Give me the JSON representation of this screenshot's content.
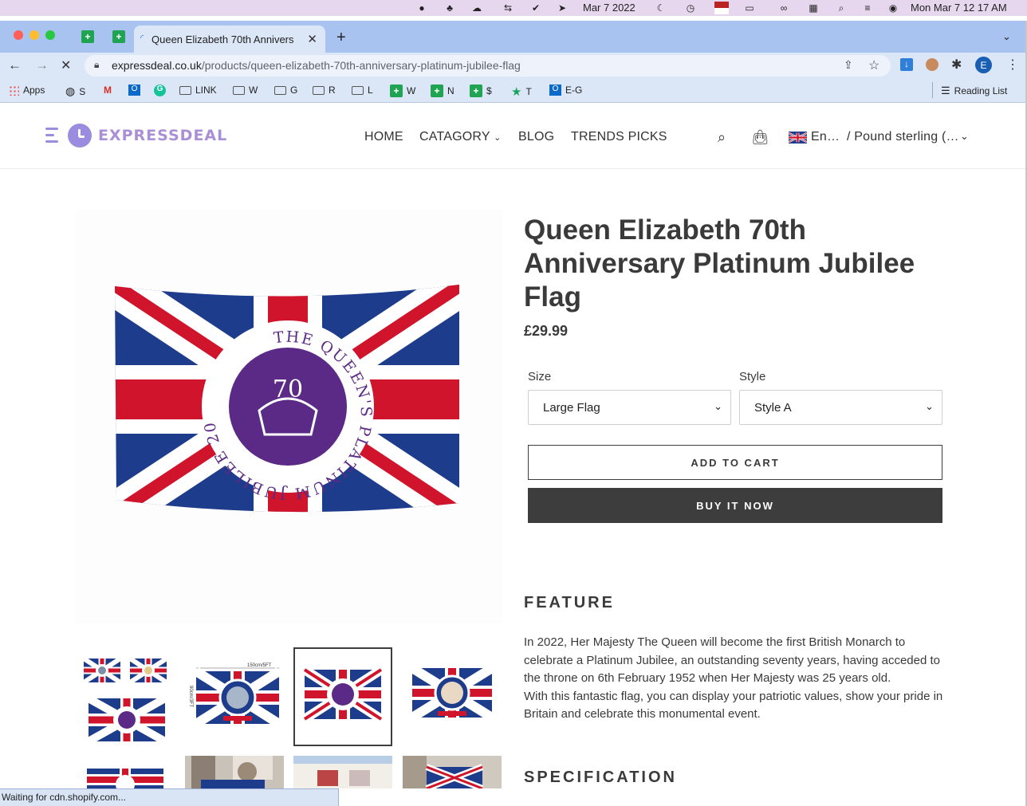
{
  "system_menubar": {
    "date_short": "Mar 7 2022",
    "clock": "Mon Mar 7  12 17 AM"
  },
  "browser": {
    "active_tab_title": "Queen Elizabeth 70th Annivers",
    "url_host": "expressdeal.co.uk",
    "url_path": "/products/queen-elizabeth-70th-anniversary-platinum-jubilee-flag",
    "profile_initial": "E",
    "bookmarks": [
      "Apps",
      "S",
      "LINK",
      "W",
      "G",
      "R",
      "L",
      "W",
      "N",
      "$",
      "T",
      "E-G"
    ],
    "reading_list": "Reading List",
    "status_text": "Waiting for cdn.shopify.com..."
  },
  "site": {
    "logo_text": "EXPRESSDEAL",
    "nav": [
      "HOME",
      "CATAGORY",
      "BLOG",
      "TRENDS PICKS"
    ],
    "locale_language": "En…",
    "locale_currency": "/ Pound sterling (…",
    "flag_text": {
      "ring": "THE QUEEN'S PLATINUM JUBILEE 2022",
      "emblem": "70"
    }
  },
  "product": {
    "title": "Queen Elizabeth 70th Anniversary Platinum Jubilee Flag",
    "price": "£29.99",
    "size_label": "Size",
    "size_value": "Large Flag",
    "style_label": "Style",
    "style_value": "Style A",
    "add_to_cart": "ADD TO CART",
    "buy_now": "BUY IT NOW",
    "feature_heading": "FEATURE",
    "feature_p1": "In 2022, Her Majesty The Queen will become the first British Monarch to celebrate a Platinum Jubilee, an outstanding seventy years, having acceded to the throne on 6th February 1952 when Her Majesty was 25 years old.",
    "feature_p2": "With this fantastic flag, you can display your patriotic values, show your pride in Britain and celebrate this monumental event.",
    "spec_heading": "SPECIFICATION",
    "thumb2_dimension": "150cm/5FT",
    "thumb2_dimension_side": "90cm/3FT"
  },
  "colors": {
    "flag_blue": "#1e3c8c",
    "flag_red": "#cf142b",
    "emblem_purple": "#5b2a86",
    "button_dark": "#3d3d3d",
    "logo_purple": "#a98fd6"
  }
}
